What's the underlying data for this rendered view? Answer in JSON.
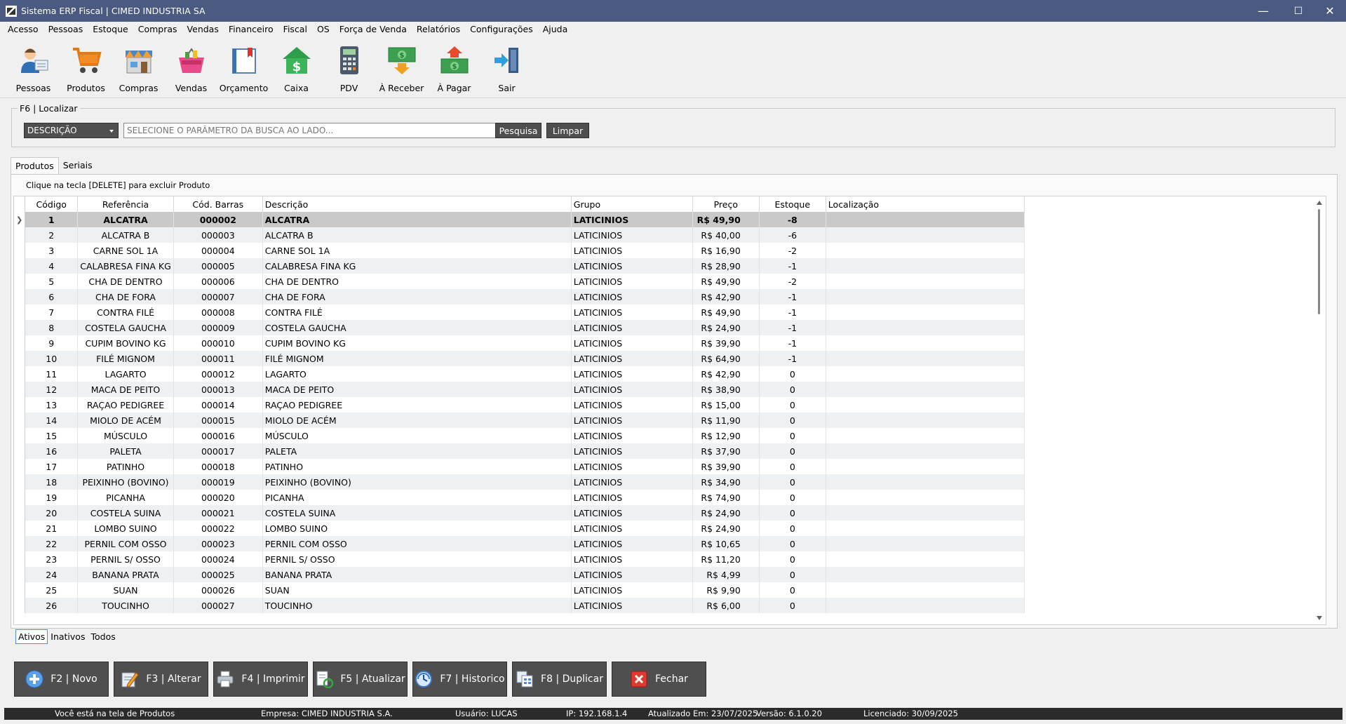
{
  "window": {
    "title": "Sistema ERP Fiscal | CIMED INDUSTRIA SA",
    "minimize": "—",
    "maximize": "☐",
    "close": "✕"
  },
  "menu": [
    "Acesso",
    "Pessoas",
    "Estoque",
    "Compras",
    "Vendas",
    "Financeiro",
    "Fiscal",
    "OS",
    "Força de Venda",
    "Relatórios",
    "Configurações",
    "Ajuda"
  ],
  "toolbar": [
    {
      "label": "Pessoas",
      "icon": "person-icon"
    },
    {
      "label": "Produtos",
      "icon": "shopping-cart-icon"
    },
    {
      "label": "Compras",
      "icon": "store-icon"
    },
    {
      "label": "Vendas",
      "icon": "shopping-basket-icon"
    },
    {
      "label": "Orçamento",
      "icon": "book-icon"
    },
    {
      "label": "Caixa",
      "icon": "cash-house-icon"
    },
    {
      "label": "PDV",
      "icon": "calculator-icon"
    },
    {
      "label": "À Receber",
      "icon": "money-receive-icon"
    },
    {
      "label": "À Pagar",
      "icon": "money-pay-icon"
    },
    {
      "label": "Sair",
      "icon": "exit-door-icon"
    }
  ],
  "search": {
    "legend": "F6 | Localizar",
    "parameter": "DESCRIÇÃO",
    "placeholder": "SELECIONE O PARÂMETRO DA BUSCA AO LADO...",
    "search_label": "Pesquisa",
    "clear_label": "Limpar"
  },
  "tabs": [
    "Produtos",
    "Seriais"
  ],
  "hint": "Clique na tecla [DELETE] para excluir Produto",
  "table": {
    "columns": [
      "Código",
      "Referência",
      "Cód. Barras",
      "Descrição",
      "Grupo",
      "Preço",
      "Estoque",
      "Localização"
    ],
    "selected_marker": "❯",
    "rows": [
      [
        "1",
        "ALCATRA",
        "000002",
        "ALCATRA",
        "LATICINIOS",
        "R$ 49,90",
        "-8",
        ""
      ],
      [
        "2",
        "ALCATRA B",
        "000003",
        "ALCATRA B",
        "LATICINIOS",
        "R$ 40,00",
        "-6",
        ""
      ],
      [
        "3",
        "CARNE SOL 1A",
        "000004",
        "CARNE SOL 1A",
        "LATICINIOS",
        "R$ 16,90",
        "-2",
        ""
      ],
      [
        "4",
        "CALABRESA FINA KG",
        "000005",
        "CALABRESA FINA KG",
        "LATICINIOS",
        "R$ 28,90",
        "-1",
        ""
      ],
      [
        "5",
        "CHA DE DENTRO",
        "000006",
        "CHA DE DENTRO",
        "LATICINIOS",
        "R$ 49,90",
        "-2",
        ""
      ],
      [
        "6",
        "CHA DE FORA",
        "000007",
        "CHA DE FORA",
        "LATICINIOS",
        "R$ 42,90",
        "-1",
        ""
      ],
      [
        "7",
        "CONTRA FILÉ",
        "000008",
        "CONTRA FILÉ",
        "LATICINIOS",
        "R$ 49,90",
        "-1",
        ""
      ],
      [
        "8",
        "COSTELA GAUCHA",
        "000009",
        "COSTELA GAUCHA",
        "LATICINIOS",
        "R$ 24,90",
        "-1",
        ""
      ],
      [
        "9",
        "CUPIM BOVINO KG",
        "000010",
        "CUPIM BOVINO KG",
        "LATICINIOS",
        "R$ 39,90",
        "-1",
        ""
      ],
      [
        "10",
        "FILÉ MIGNOM",
        "000011",
        "FILÉ MIGNOM",
        "LATICINIOS",
        "R$ 64,90",
        "-1",
        ""
      ],
      [
        "11",
        "LAGARTO",
        "000012",
        "LAGARTO",
        "LATICINIOS",
        "R$ 42,90",
        "0",
        ""
      ],
      [
        "12",
        "MACA DE PEITO",
        "000013",
        "MACA DE PEITO",
        "LATICINIOS",
        "R$ 38,90",
        "0",
        ""
      ],
      [
        "13",
        "RAÇAO PEDIGREE",
        "000014",
        "RAÇAO PEDIGREE",
        "LATICINIOS",
        "R$ 15,00",
        "0",
        ""
      ],
      [
        "14",
        "MIOLO DE ACÉM",
        "000015",
        "MIOLO DE ACÉM",
        "LATICINIOS",
        "R$ 11,90",
        "0",
        ""
      ],
      [
        "15",
        "MÚSCULO",
        "000016",
        "MÚSCULO",
        "LATICINIOS",
        "R$ 12,90",
        "0",
        ""
      ],
      [
        "16",
        "PALETA",
        "000017",
        "PALETA",
        "LATICINIOS",
        "R$ 37,90",
        "0",
        ""
      ],
      [
        "17",
        "PATINHO",
        "000018",
        "PATINHO",
        "LATICINIOS",
        "R$ 39,90",
        "0",
        ""
      ],
      [
        "18",
        "PEIXINHO (BOVINO)",
        "000019",
        "PEIXINHO (BOVINO)",
        "LATICINIOS",
        "R$ 34,90",
        "0",
        ""
      ],
      [
        "19",
        "PICANHA",
        "000020",
        "PICANHA",
        "LATICINIOS",
        "R$ 74,90",
        "0",
        ""
      ],
      [
        "20",
        "COSTELA SUINA",
        "000021",
        "COSTELA SUINA",
        "LATICINIOS",
        "R$ 24,90",
        "0",
        ""
      ],
      [
        "21",
        "LOMBO SUINO",
        "000022",
        "LOMBO SUINO",
        "LATICINIOS",
        "R$ 24,90",
        "0",
        ""
      ],
      [
        "22",
        "PERNIL COM OSSO",
        "000023",
        "PERNIL COM OSSO",
        "LATICINIOS",
        "R$ 10,65",
        "0",
        ""
      ],
      [
        "23",
        "PERNIL S/ OSSO",
        "000024",
        "PERNIL S/ OSSO",
        "LATICINIOS",
        "R$ 11,20",
        "0",
        ""
      ],
      [
        "24",
        "BANANA PRATA",
        "000025",
        "BANANA PRATA",
        "LATICINIOS",
        "R$ 4,99",
        "0",
        ""
      ],
      [
        "25",
        "SUAN",
        "000026",
        "SUAN",
        "LATICINIOS",
        "R$ 9,90",
        "0",
        ""
      ],
      [
        "26",
        "TOUCINHO",
        "000027",
        "TOUCINHO",
        "LATICINIOS",
        "R$ 6,00",
        "0",
        ""
      ]
    ]
  },
  "filter_tabs": [
    "Ativos",
    "Inativos",
    "Todos"
  ],
  "actions": [
    {
      "label": "F2 | Novo",
      "icon": "add-circle-icon"
    },
    {
      "label": "F3 | Alterar",
      "icon": "edit-pencil-icon"
    },
    {
      "label": "F4 | Imprimir",
      "icon": "printer-icon"
    },
    {
      "label": "F5 | Atualizar",
      "icon": "refresh-document-icon"
    },
    {
      "label": "F7 | Historico",
      "icon": "history-icon"
    },
    {
      "label": "F8 | Duplicar",
      "icon": "duplicate-icon"
    },
    {
      "label": "Fechar",
      "icon": "close-x-icon"
    }
  ],
  "status": {
    "screen": "Você está na tela de Produtos",
    "company": "Empresa: CIMED INDUSTRIA S.A.",
    "user": "Usuário: LUCAS",
    "ip": "IP: 192.168.1.4",
    "updated": "Atualizado Em: 23/07/2025",
    "version": "Versão: 6.1.0.20",
    "license": "Licenciado: 30/09/2025"
  },
  "colors": {
    "titlebar": "#4a5a80",
    "dark_button": "#4f4f4f",
    "selected_row": "#c9c9c9",
    "alt_row": "#eef1f4",
    "statusbar": "#2b2b2b"
  }
}
